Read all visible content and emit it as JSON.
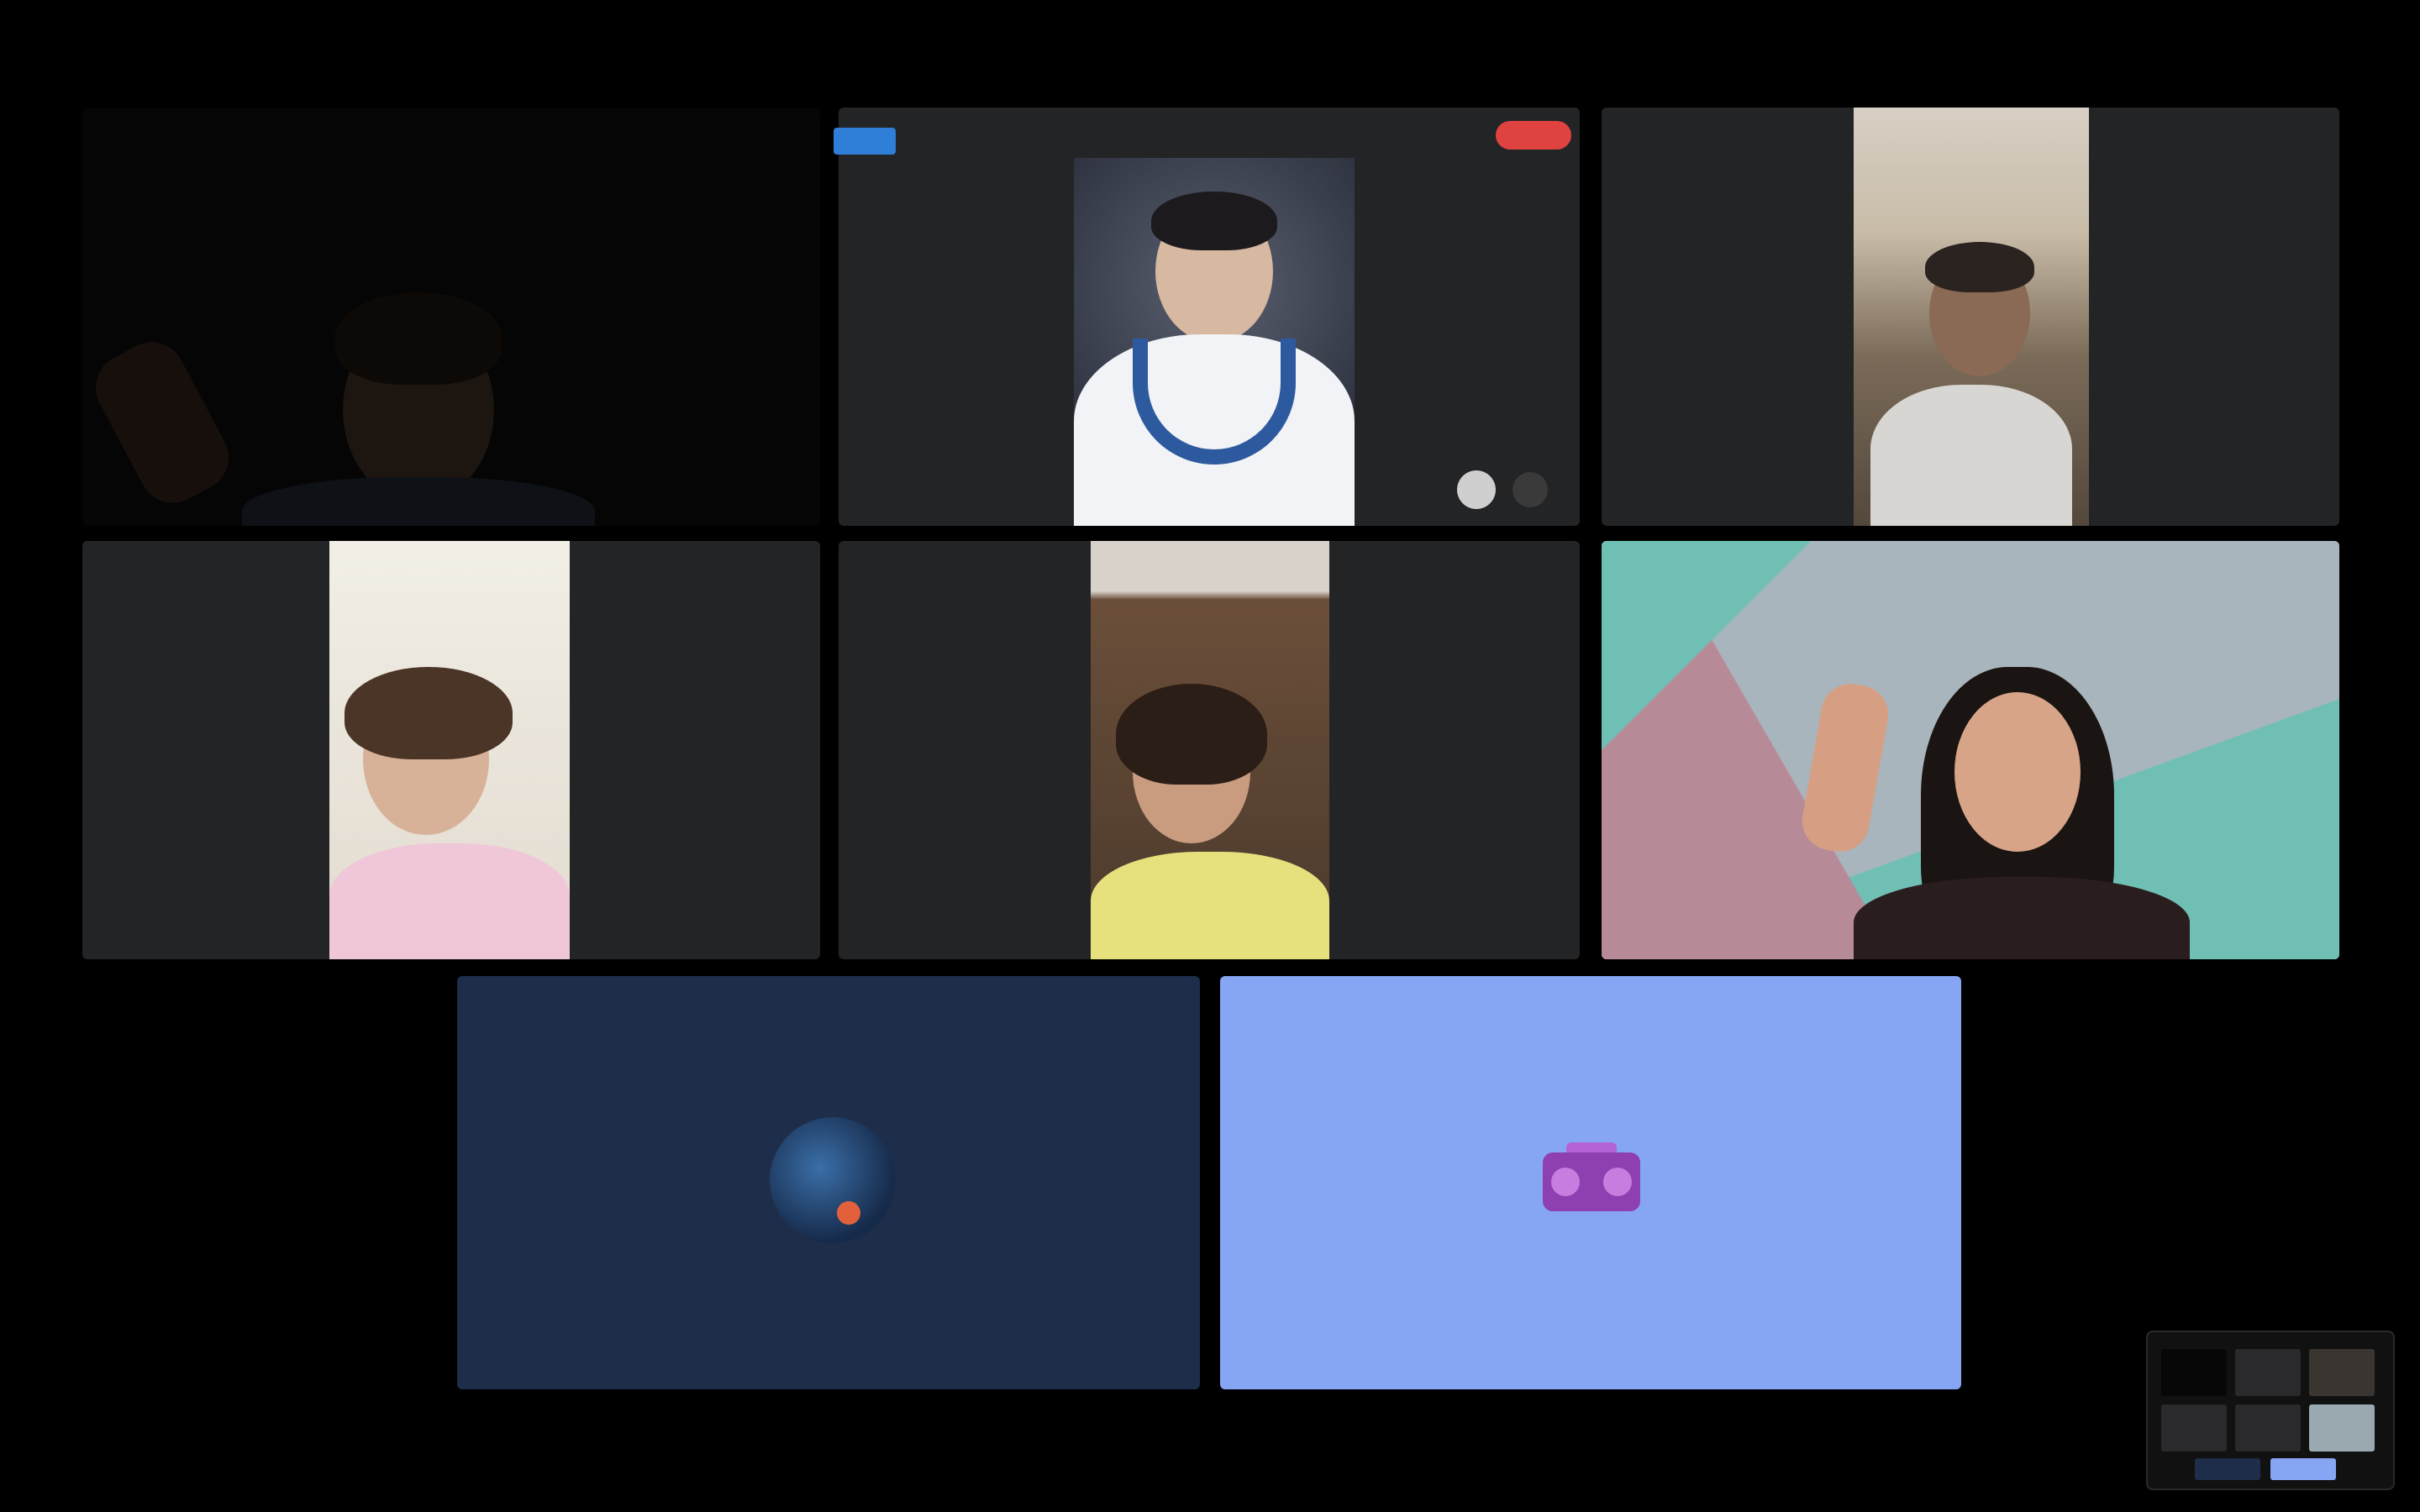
{
  "app": {
    "type": "video-meeting-gallery-view"
  },
  "participants": [
    {
      "id": "tile-1",
      "video": "dim-webcam"
    },
    {
      "id": "tile-2",
      "video": "screen-share-photo"
    },
    {
      "id": "tile-3",
      "video": "webcam-portrait"
    },
    {
      "id": "tile-4",
      "video": "webcam-portrait"
    },
    {
      "id": "tile-5",
      "video": "webcam-portrait"
    },
    {
      "id": "tile-6",
      "video": "webcam-wide"
    },
    {
      "id": "tile-7",
      "video": "off",
      "avatar": "space-planet-icon"
    },
    {
      "id": "tile-8",
      "video": "off",
      "avatar": "boombox-icon"
    }
  ],
  "colors": {
    "background": "#000000",
    "tile": "#232426",
    "tile7_bg": "#1e2d49",
    "tile8_bg": "#86a6f3",
    "share_badge": "#2f7fd9",
    "record_badge": "#e0433f"
  },
  "mini_view": {
    "icon": "thumbnail-strip"
  }
}
